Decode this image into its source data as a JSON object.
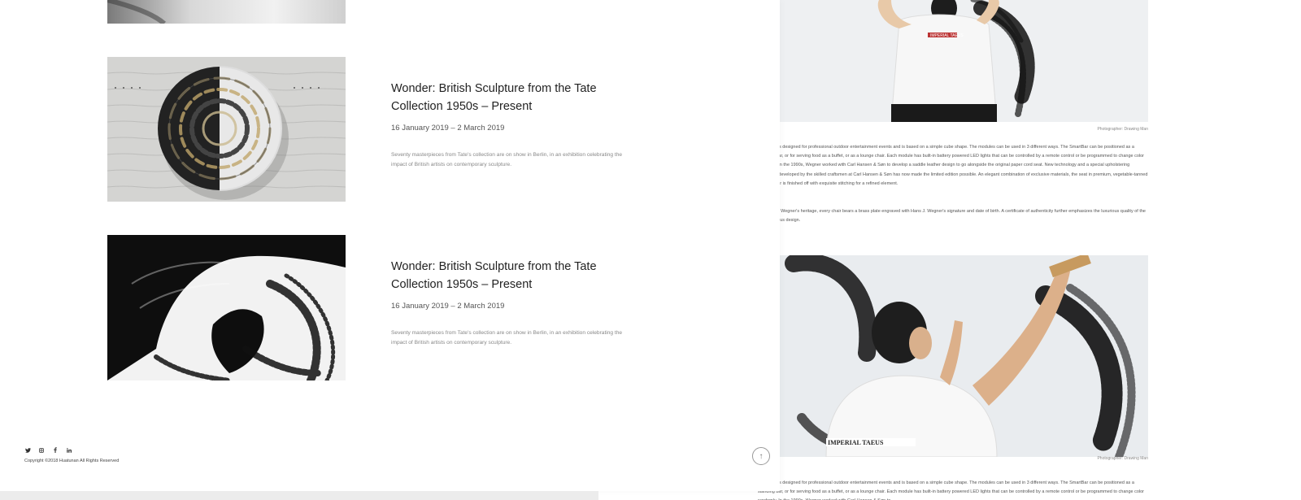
{
  "background_article": {
    "caption_1": "Photographer: Drawing Man",
    "caption_2": "Photographer: Drawing Man",
    "para_1": "SmartBar is designed for professional outdoor entertainment events and is based on a simple cube shape. The modules can be used in 3 different ways. The SmartBar can be positioned as a standing bar, or for serving food as a buffet, or as a lounge chair. Each module has built-in battery powered LED lights that can be controlled by a remote control or be programmed to change color randomly. In the 1990s, Wegner worked with Carl Hansen & Søn to develop a saddle leather design to go alongside the original paper cord seat. New technology and a special upholstering technique developed by the skilled craftsmen at Carl Hansen & Søn has now made the limited edition possible. An elegant combination of exclusive materials, the seat in premium, vegetable-tanned goat leather is finished off with exquisite stitching for a refined element.",
    "para_2": "Cementing Wegner's heritage, every chair bears a brass plate engraved with Hans J. Wegner's signature and date of birth. A certificate of authenticity further emphasizes the luxurious quality of the world-famous design.",
    "para_3": "SmartBar is designed for professional outdoor entertainment events and is based on a simple cube shape. The modules can be used in 3 different ways. The SmartBar can be positioned as a standing bar, or for serving food as a buffet, or as a lounge chair. Each module has built-in battery powered LED lights that can be controlled by a remote control or be programmed to change color randomly. In the 1990s, Wegner worked with Carl Hansen & Søn to",
    "shirt_text": "IMPERIAL TAEUS"
  },
  "events": [
    {
      "title": "Wonder: British Sculpture from the Tate Collection 1950s – Present",
      "date": "16 January 2019 – 2 March 2019",
      "desc": "Seventy masterpieces from Tate's collection are on show in Berlin, in an exhibition celebrating the impact of British artists on contemporary sculpture."
    },
    {
      "title": "Wonder: British Sculpture from the Tate Collection 1950s – Present",
      "date": "16 January 2019 – 2 March 2019",
      "desc": "Seventy masterpieces from Tate's collection are on show in Berlin, in an exhibition celebrating the impact of British artists on contemporary sculpture."
    }
  ],
  "footer": {
    "copyright": "Copyright ©2018 Huatunan All Rights Reserved",
    "social_icons": [
      "twitter-icon",
      "instagram-icon",
      "facebook-icon",
      "linkedin-icon"
    ]
  },
  "back_to_top_icon": "arrow-up-icon",
  "colors": {
    "background": "#ffffff",
    "title_text": "#222222",
    "muted_text": "#888888"
  }
}
